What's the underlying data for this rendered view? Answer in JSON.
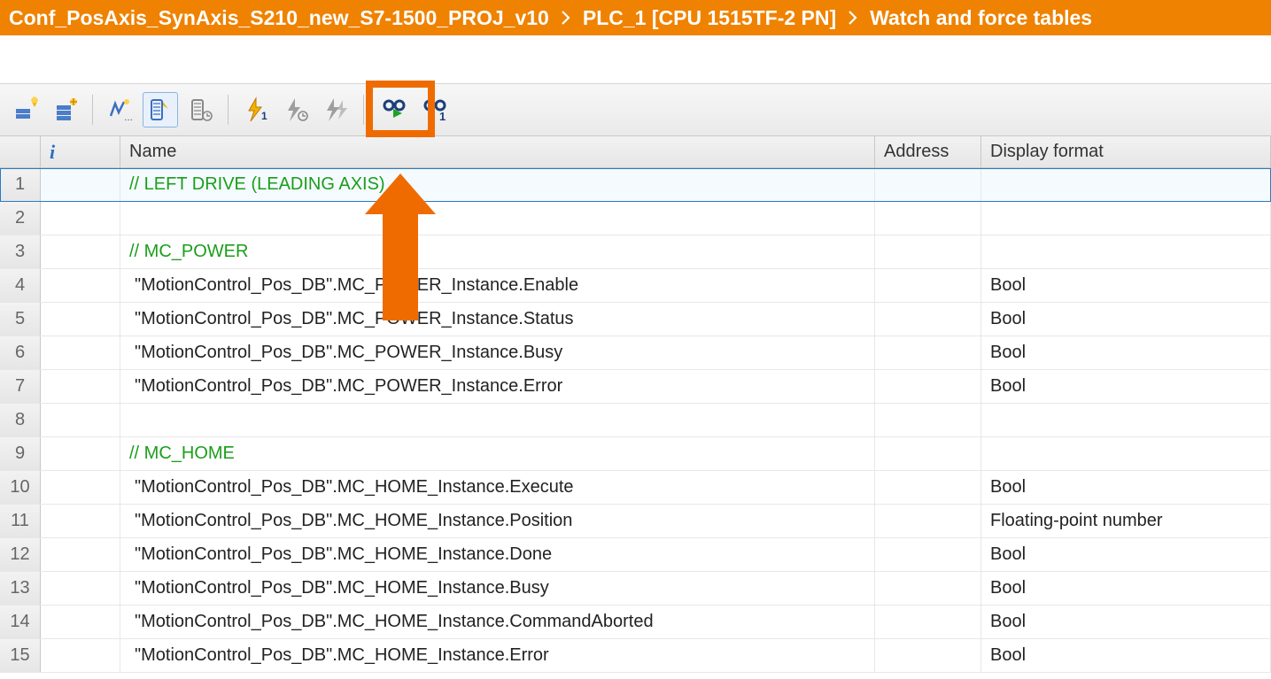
{
  "breadcrumb": {
    "project": "Conf_PosAxis_SynAxis_S210_new_S7-1500_PROJ_v10",
    "plc": "PLC_1 [CPU 1515TF-2 PN]",
    "section": "Watch and force tables"
  },
  "columns": {
    "info": "i",
    "name": "Name",
    "address": "Address",
    "display": "Display format"
  },
  "rows": [
    {
      "n": "1",
      "type": "comment",
      "name": "// LEFT DRIVE (LEADING AXIS)",
      "addr": "",
      "disp": "",
      "selected": true
    },
    {
      "n": "2",
      "type": "blank",
      "name": "",
      "addr": "",
      "disp": ""
    },
    {
      "n": "3",
      "type": "comment",
      "name": "// MC_POWER",
      "addr": "",
      "disp": ""
    },
    {
      "n": "4",
      "type": "var",
      "name": "\"MotionControl_Pos_DB\".MC_POWER_Instance.Enable",
      "addr": "",
      "disp": "Bool"
    },
    {
      "n": "5",
      "type": "var",
      "name": "\"MotionControl_Pos_DB\".MC_POWER_Instance.Status",
      "addr": "",
      "disp": "Bool"
    },
    {
      "n": "6",
      "type": "var",
      "name": "\"MotionControl_Pos_DB\".MC_POWER_Instance.Busy",
      "addr": "",
      "disp": "Bool"
    },
    {
      "n": "7",
      "type": "var",
      "name": "\"MotionControl_Pos_DB\".MC_POWER_Instance.Error",
      "addr": "",
      "disp": "Bool"
    },
    {
      "n": "8",
      "type": "blank",
      "name": "",
      "addr": "",
      "disp": ""
    },
    {
      "n": "9",
      "type": "comment",
      "name": "// MC_HOME",
      "addr": "",
      "disp": ""
    },
    {
      "n": "10",
      "type": "var",
      "name": "\"MotionControl_Pos_DB\".MC_HOME_Instance.Execute",
      "addr": "",
      "disp": "Bool"
    },
    {
      "n": "11",
      "type": "var",
      "name": "\"MotionControl_Pos_DB\".MC_HOME_Instance.Position",
      "addr": "",
      "disp": "Floating-point number"
    },
    {
      "n": "12",
      "type": "var",
      "name": "\"MotionControl_Pos_DB\".MC_HOME_Instance.Done",
      "addr": "",
      "disp": "Bool"
    },
    {
      "n": "13",
      "type": "var",
      "name": "\"MotionControl_Pos_DB\".MC_HOME_Instance.Busy",
      "addr": "",
      "disp": "Bool"
    },
    {
      "n": "14",
      "type": "var",
      "name": "\"MotionControl_Pos_DB\".MC_HOME_Instance.CommandAborted",
      "addr": "",
      "disp": "Bool"
    },
    {
      "n": "15",
      "type": "var",
      "name": "\"MotionControl_Pos_DB\".MC_HOME_Instance.Error",
      "addr": "",
      "disp": "Bool"
    }
  ]
}
